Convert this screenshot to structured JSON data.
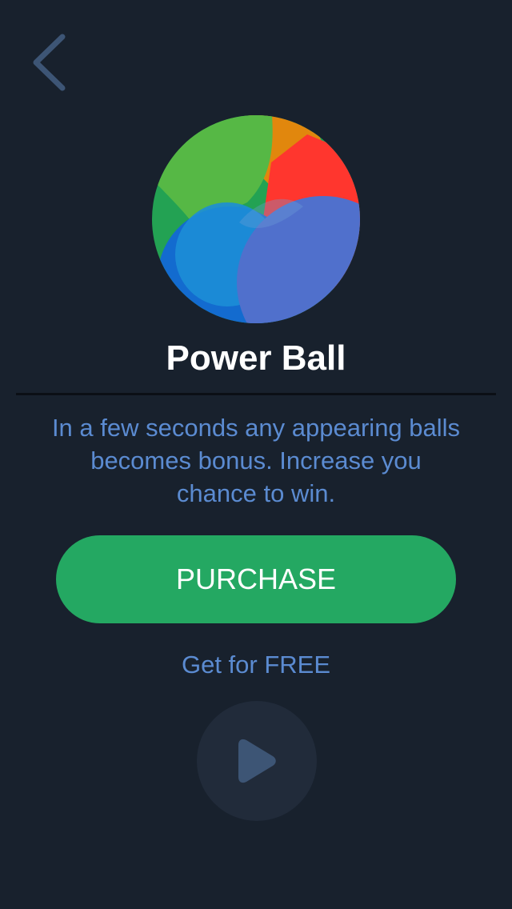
{
  "header": {
    "back_icon": "chevron-left-icon"
  },
  "item": {
    "icon": "power-ball-icon",
    "title": "Power Ball",
    "description": "In a few seconds any appearing balls becomes bonus. Increase you chance to win."
  },
  "actions": {
    "purchase_label": "PURCHASE",
    "free_label": "Get for FREE",
    "play_icon": "play-icon"
  },
  "colors": {
    "background": "#18212d",
    "accent_green": "#24a862",
    "text_blue": "#5b8bd1",
    "back_icon": "#3d5575",
    "play_circle": "#212b3a",
    "play_icon": "#3d5575",
    "ball_green": "#56b845",
    "ball_dark_green": "#23a253",
    "ball_orange": "#e1870d",
    "ball_red": "#ff362e",
    "ball_blue": "#136bcf",
    "ball_light_blue": "#1d8ed6",
    "ball_purple_blue": "#5070cc"
  }
}
